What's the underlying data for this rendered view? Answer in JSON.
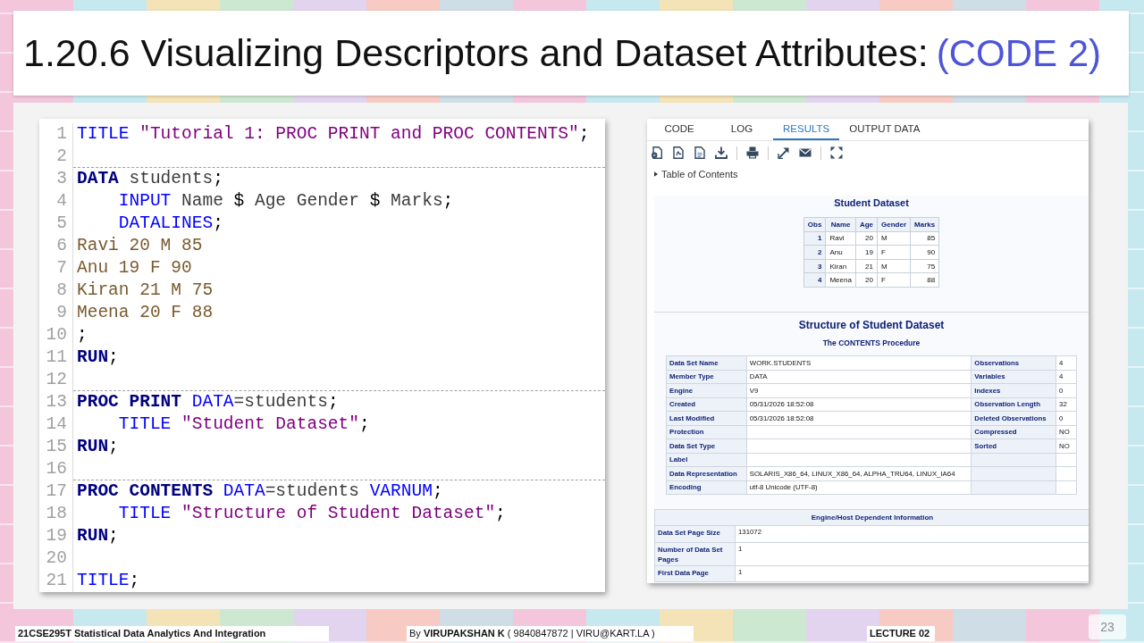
{
  "slide_title": {
    "text": "1.20.6 Visualizing Descriptors and Dataset Attributes:",
    "tag": "(CODE 2)"
  },
  "code_editor": {
    "lines": [
      {
        "number": "1",
        "section_break": false,
        "tokens": [
          {
            "kind": "statement",
            "text": "TITLE"
          },
          {
            "kind": "string",
            "text": " \"Tutorial 1: PROC PRINT and PROC CONTENTS\""
          },
          {
            "kind": "punct",
            "text": ";"
          }
        ]
      },
      {
        "number": "2",
        "section_break": true
      },
      {
        "number": "3",
        "section_break": false,
        "tokens": [
          {
            "kind": "keyword",
            "text": "DATA"
          },
          {
            "kind": "plain",
            "text": " students"
          },
          {
            "kind": "punct",
            "text": ";"
          }
        ]
      },
      {
        "number": "4",
        "section_break": false,
        "tokens": [
          {
            "kind": "statement",
            "text": "    INPUT"
          },
          {
            "kind": "plain",
            "text": " Name "
          },
          {
            "kind": "punct",
            "text": "$"
          },
          {
            "kind": "plain",
            "text": " Age Gender "
          },
          {
            "kind": "punct",
            "text": "$"
          },
          {
            "kind": "plain",
            "text": " Marks"
          },
          {
            "kind": "punct",
            "text": ";"
          }
        ]
      },
      {
        "number": "5",
        "section_break": false,
        "tokens": [
          {
            "kind": "statement",
            "text": "    DATALINES"
          },
          {
            "kind": "punct",
            "text": ";"
          }
        ]
      },
      {
        "number": "6",
        "section_break": false,
        "tokens": [
          {
            "kind": "data",
            "text": "Ravi 20 M 85"
          }
        ]
      },
      {
        "number": "7",
        "section_break": false,
        "tokens": [
          {
            "kind": "data",
            "text": "Anu 19 F 90"
          }
        ]
      },
      {
        "number": "8",
        "section_break": false,
        "tokens": [
          {
            "kind": "data",
            "text": "Kiran 21 M 75"
          }
        ]
      },
      {
        "number": "9",
        "section_break": false,
        "tokens": [
          {
            "kind": "data",
            "text": "Meena 20 F 88"
          }
        ]
      },
      {
        "number": "10",
        "section_break": false,
        "tokens": [
          {
            "kind": "punct",
            "text": ";"
          }
        ]
      },
      {
        "number": "11",
        "section_break": false,
        "tokens": [
          {
            "kind": "keyword",
            "text": "RUN"
          },
          {
            "kind": "punct",
            "text": ";"
          }
        ]
      },
      {
        "number": "12",
        "section_break": true
      },
      {
        "number": "13",
        "section_break": false,
        "tokens": [
          {
            "kind": "keyword",
            "text": "PROC PRINT"
          },
          {
            "kind": "statement",
            "text": " DATA"
          },
          {
            "kind": "plain",
            "text": "=students"
          },
          {
            "kind": "punct",
            "text": ";"
          }
        ]
      },
      {
        "number": "14",
        "section_break": false,
        "tokens": [
          {
            "kind": "statement",
            "text": "    TITLE"
          },
          {
            "kind": "string",
            "text": " \"Student Dataset\""
          },
          {
            "kind": "punct",
            "text": ";"
          }
        ]
      },
      {
        "number": "15",
        "section_break": false,
        "tokens": [
          {
            "kind": "keyword",
            "text": "RUN"
          },
          {
            "kind": "punct",
            "text": ";"
          }
        ]
      },
      {
        "number": "16",
        "section_break": true
      },
      {
        "number": "17",
        "section_break": false,
        "tokens": [
          {
            "kind": "keyword",
            "text": "PROC CONTENTS"
          },
          {
            "kind": "statement",
            "text": " DATA"
          },
          {
            "kind": "plain",
            "text": "=students"
          },
          {
            "kind": "statement",
            "text": " VARNUM"
          },
          {
            "kind": "punct",
            "text": ";"
          }
        ]
      },
      {
        "number": "18",
        "section_break": false,
        "tokens": [
          {
            "kind": "statement",
            "text": "    TITLE"
          },
          {
            "kind": "string",
            "text": " \"Structure of Student Dataset\""
          },
          {
            "kind": "punct",
            "text": ";"
          }
        ]
      },
      {
        "number": "19",
        "section_break": false,
        "tokens": [
          {
            "kind": "keyword",
            "text": "RUN"
          },
          {
            "kind": "punct",
            "text": ";"
          }
        ]
      },
      {
        "number": "20",
        "section_break": false
      },
      {
        "number": "21",
        "section_break": false,
        "tokens": [
          {
            "kind": "statement",
            "text": "TITLE"
          },
          {
            "kind": "punct",
            "text": ";"
          }
        ]
      }
    ]
  },
  "results_viewer": {
    "tabs": [
      {
        "label": "CODE",
        "selected": false
      },
      {
        "label": "LOG",
        "selected": false
      },
      {
        "label": "RESULTS",
        "selected": true
      },
      {
        "label": "OUTPUT DATA",
        "selected": false
      }
    ],
    "table_of_contents": {
      "label": "Table of Contents",
      "expanded": false
    },
    "print_output": {
      "title": "Student Dataset",
      "columns": [
        {
          "label": "Obs",
          "numeric": true
        },
        {
          "label": "Name",
          "numeric": false
        },
        {
          "label": "Age",
          "numeric": true
        },
        {
          "label": "Gender",
          "numeric": false
        },
        {
          "label": "Marks",
          "numeric": true
        }
      ],
      "rows": [
        [
          "1",
          "Ravi",
          "20",
          "M",
          "85"
        ],
        [
          "2",
          "Anu",
          "19",
          "F",
          "90"
        ],
        [
          "3",
          "Kiran",
          "21",
          "M",
          "75"
        ],
        [
          "4",
          "Meena",
          "20",
          "F",
          "88"
        ]
      ]
    },
    "contents_output": {
      "title": "Structure of Student Dataset",
      "subtitle": "The CONTENTS Procedure",
      "attributes": [
        {
          "name": "Data Set Name",
          "value": "WORK.STUDENTS",
          "name_2": "Observations",
          "value_2": "4"
        },
        {
          "name": "Member Type",
          "value": "DATA",
          "name_2": "Variables",
          "value_2": "4"
        },
        {
          "name": "Engine",
          "value": "V9",
          "name_2": "Indexes",
          "value_2": "0"
        },
        {
          "name": "Created",
          "value": "05/31/2026 18:52:08",
          "name_2": "Observation Length",
          "value_2": "32"
        },
        {
          "name": "Last Modified",
          "value": "05/31/2026 18:52:08",
          "name_2": "Deleted Observations",
          "value_2": "0"
        },
        {
          "name": "Protection",
          "name_2": "Compressed",
          "value_2": "NO"
        },
        {
          "name": "Data Set Type",
          "name_2": "Sorted",
          "value_2": "NO"
        },
        {
          "name": "Label"
        },
        {
          "name": "Data Representation",
          "value": "SOLARIS_X86_64, LINUX_X86_64, ALPHA_TRU64, LINUX_IA64"
        },
        {
          "name": "Encoding",
          "value": "utf-8 Unicode (UTF-8)"
        }
      ]
    },
    "engine_host": {
      "title": "Engine/Host Dependent Information",
      "rows": [
        {
          "name": "Data Set Page Size",
          "value": "131072"
        },
        {
          "name": "Number of Data Set Pages",
          "value": "1"
        },
        {
          "name": "First Data Page",
          "value": "1"
        }
      ]
    }
  },
  "footer": {
    "course": "21CSE295T Statistical Data Analytics And Integration",
    "author": "By **VIRUPAKSHAN K** ( 9840847872 | VIRU@KART.LA )",
    "lecture": "LECTURE 02",
    "page_number": "23"
  }
}
